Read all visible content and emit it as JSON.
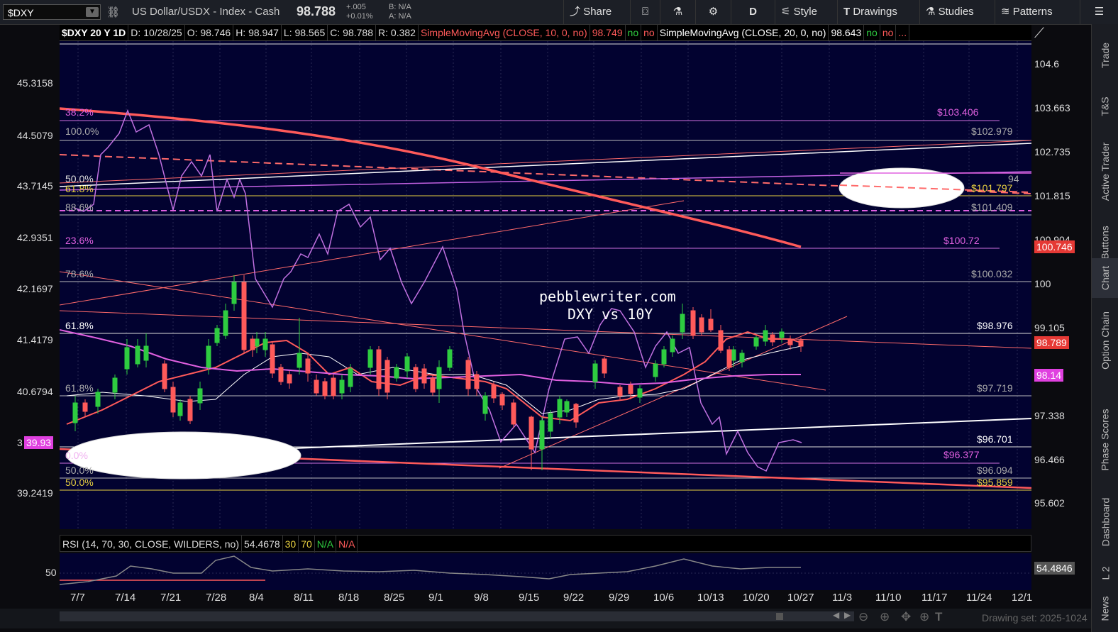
{
  "toolbar": {
    "symbol": "$DXY",
    "description": "US Dollar/USDX - Index - Cash",
    "last": "98.788",
    "change": "+.005",
    "change_pct": "+0.01%",
    "bid": "B: N/A",
    "ask": "A: N/A",
    "share": "Share",
    "period": "D",
    "style": "Style",
    "drawings": "Drawings",
    "studies": "Studies",
    "patterns": "Patterns"
  },
  "header": {
    "title": "$DXY 20 Y 1D",
    "date": "D: 10/28/25",
    "open": "O: 98.746",
    "high": "H: 98.947",
    "low": "L: 98.565",
    "close": "C: 98.788",
    "range": "R: 0.382",
    "sma10": "SimpleMovingAvg (CLOSE, 10, 0, no)",
    "sma10_val": "98.749",
    "no1": "no",
    "no2": "no",
    "sma20": "SimpleMovingAvg (CLOSE, 20, 0, no)",
    "sma20_val": "98.643",
    "no3": "no",
    "no4": "no",
    "more": "..."
  },
  "left_axis": [
    "45.3158",
    "44.5079",
    "43.7145",
    "42.9351",
    "42.1697",
    "41.4179",
    "40.6794",
    "3",
    "39.2419"
  ],
  "left_badge": "39.93",
  "right_axis": [
    "104.6",
    "103.663",
    "102.735",
    "101.815",
    "100.904",
    "100",
    "99.105",
    "97.338",
    "96.466",
    "95.602"
  ],
  "price_badges": {
    "last": "100.746",
    "close": "98.789",
    "ma": "98.14"
  },
  "fib_left": {
    "f382": "38.2%",
    "f100": "100.0%",
    "f50a": "50.0%",
    "f618a": "61.8%",
    "f886": "88.6%",
    "f236": "23.6%",
    "f786": "78.6%",
    "f618b": "61.8%",
    "f618c": "61.8%",
    "f00": "0.0%",
    "f50b": "50.0%",
    "f50c": "50.0%"
  },
  "fib_right": {
    "p103406": "$103.406",
    "p102979": "$102.979",
    "p101797": "$101.797",
    "p101409": "$101.409",
    "p10072": "$100.72",
    "p100032": "$100.032",
    "p98976": "$98.976",
    "p97719": "$97.719",
    "p96701": "$96.701",
    "p96377": "$96.377",
    "p96094": "$96.094",
    "p95859": "$95.859",
    "p94": "94"
  },
  "watermark": {
    "line1": "pebblewriter.com",
    "line2": "DXY vs 10Y"
  },
  "rsi": {
    "label": "RSI (14, 70, 30, CLOSE, WILDERS, no)",
    "value": "54.4678",
    "ob": "30",
    "os": "70",
    "na1": "N/A",
    "na2": "N/A",
    "level": "50",
    "badge": "54.4846"
  },
  "xaxis": [
    "7/7",
    "7/14",
    "7/21",
    "7/28",
    "8/4",
    "8/11",
    "8/18",
    "8/25",
    "9/1",
    "9/8",
    "9/15",
    "9/22",
    "9/29",
    "10/6",
    "10/13",
    "10/20",
    "10/27",
    "11/3",
    "11/10",
    "11/17",
    "11/24",
    "12/1"
  ],
  "sidebar": [
    "Trade",
    "T&S",
    "Active Trader",
    "Buttons",
    "Chart",
    "Option Chain",
    "Phase Scores",
    "Dashboard",
    "L 2",
    "News"
  ],
  "drawing_set": "Drawing set: 2025-1024"
}
